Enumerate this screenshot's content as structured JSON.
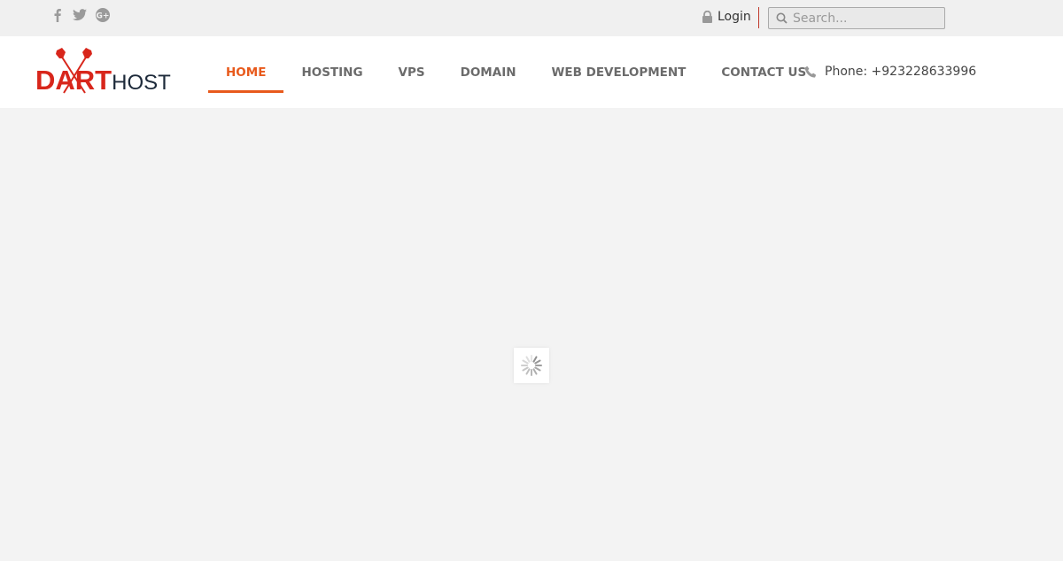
{
  "topbar": {
    "social": [
      {
        "name": "facebook",
        "icon": "facebook-icon"
      },
      {
        "name": "twitter",
        "icon": "twitter-icon"
      },
      {
        "name": "google-plus",
        "icon": "google-plus-icon"
      }
    ],
    "login_label": "Login",
    "search_placeholder": "Search..."
  },
  "header": {
    "logo": {
      "primary": "DART",
      "secondary": "HOST"
    },
    "nav": [
      {
        "label": "HOME",
        "active": true
      },
      {
        "label": "HOSTING",
        "active": false
      },
      {
        "label": "VPS",
        "active": false
      },
      {
        "label": "DOMAIN",
        "active": false
      },
      {
        "label": "WEB DEVELOPMENT",
        "active": false
      },
      {
        "label": "CONTACT US",
        "active": false
      }
    ],
    "phone": "Phone: +923228633996"
  },
  "colors": {
    "accent": "#e85a1c",
    "brand_red": "#d8261b",
    "brand_dark": "#1d2a3a"
  },
  "content": {
    "state": "loading",
    "icon": "spinner-icon"
  }
}
